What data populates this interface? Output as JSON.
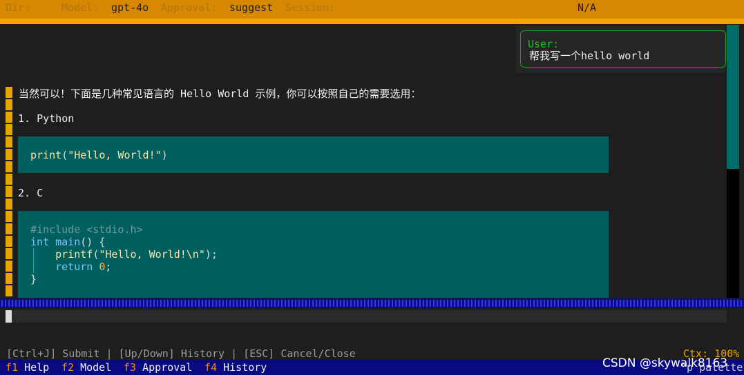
{
  "topbar": {
    "dir_label": "Dir:",
    "model_label": "Model:",
    "model_value": "gpt-4o",
    "approval_label": "Approval:",
    "approval_value": "suggest",
    "session_label": "Session:",
    "session_value": "N/A"
  },
  "user_message": {
    "label": "User:",
    "text": "帮我写一个hello world"
  },
  "assistant": {
    "intro": "当然可以！下面是几种常见语言的 Hello World 示例，你可以按照自己的需要选用：",
    "item1": "1. Python",
    "python_code": {
      "fn": "print",
      "open": "(",
      "str": "\"Hello, World!\"",
      "close": ")"
    },
    "item2": "2. C",
    "c_code": {
      "include": "#include <stdio.h>",
      "int_kw": "int",
      "main_fn": "main",
      "main_rest": "() {",
      "printf_fn": "printf",
      "printf_open": "(",
      "printf_str": "\"Hello, World!\\n\"",
      "printf_close": ");",
      "return_kw": "return",
      "zero": "0",
      "semicolon": ";",
      "close_brace": "}"
    }
  },
  "footer": {
    "hints": "[Ctrl+J] Submit | [Up/Down] History | [ESC] Cancel/Close",
    "ctx": "Ctx: 100%",
    "f1_key": "f1",
    "f1_label": "Help",
    "f2_key": "f2",
    "f2_label": "Model",
    "f3_key": "f3",
    "f3_label": "Approval",
    "f4_key": "f4",
    "f4_label": "History",
    "palette": "^p palette"
  },
  "watermark": "CSDN @skywalk8163",
  "colors": {
    "topbar": "#d78700",
    "accent": "#e8a400",
    "code_bg": "#006060",
    "fkeybar": "#0a0a80",
    "user_border": "#14a814"
  }
}
